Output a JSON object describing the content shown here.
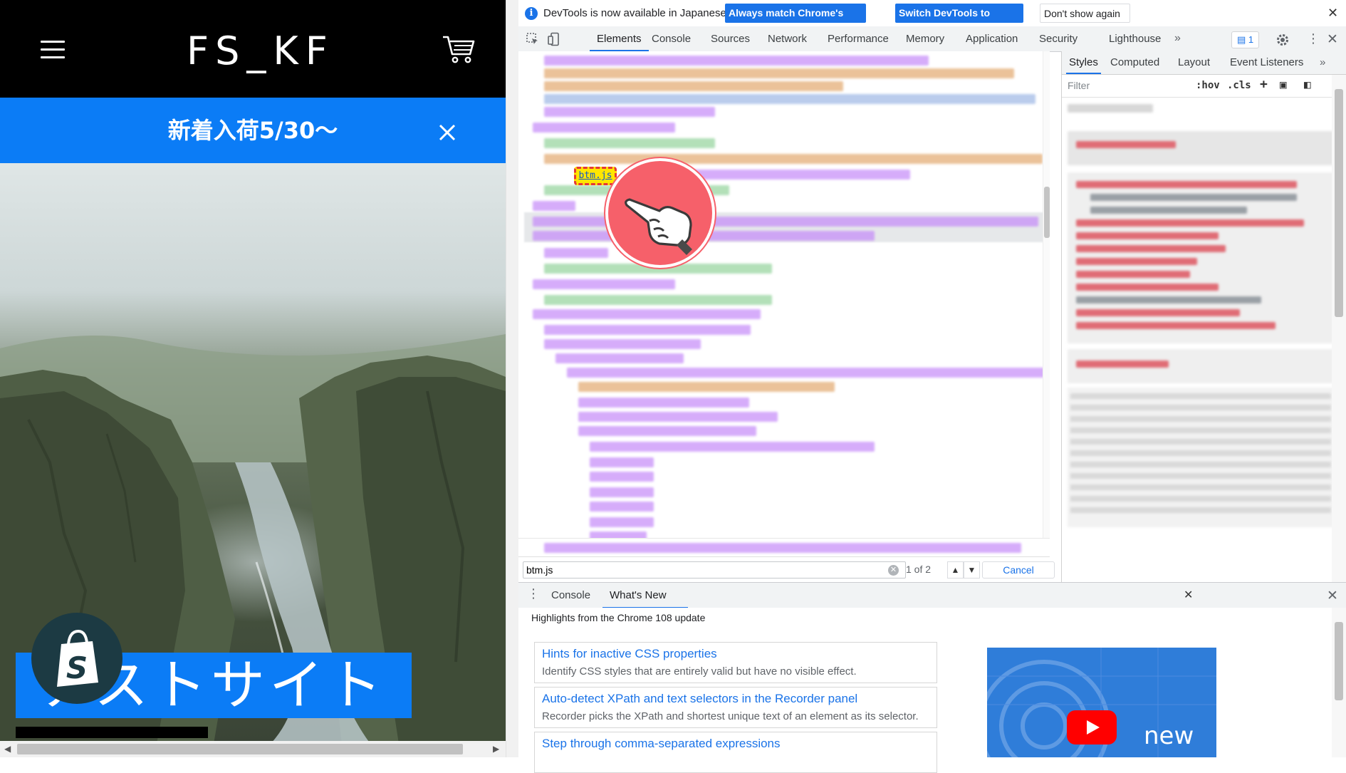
{
  "site": {
    "logo": "FS_KF",
    "announcement": "新着入荷5/30〜",
    "hero_title": "テストサイト"
  },
  "devtools": {
    "infobar": {
      "message": "DevTools is now available in Japanese!",
      "btn_always_match": "Always match Chrome's language",
      "btn_switch": "Switch DevTools to Japanese",
      "btn_dont_show": "Don't show again"
    },
    "main_tabs": [
      "Elements",
      "Console",
      "Sources",
      "Network",
      "Performance",
      "Memory",
      "Application",
      "Security",
      "Lighthouse"
    ],
    "issues_count": "1",
    "elements": {
      "found_text": "btm.js"
    },
    "search": {
      "value": "btm.js",
      "match_count": "1 of 2",
      "cancel_label": "Cancel"
    },
    "styles_tabs": [
      "Styles",
      "Computed",
      "Layout",
      "Event Listeners"
    ],
    "styles": {
      "filter_placeholder": "Filter",
      "hov": ":hov",
      "cls": ".cls"
    },
    "drawer": {
      "tabs": [
        "Console",
        "What's New"
      ],
      "heading": "Highlights from the Chrome 108 update",
      "features": [
        {
          "title": "Hints for inactive CSS properties",
          "desc": "Identify CSS styles that are entirely valid but have no visible effect."
        },
        {
          "title": "Auto-detect XPath and text selectors in the Recorder panel",
          "desc": "Recorder picks the XPath and shortest unique text of an element as its selector."
        },
        {
          "title": "Step through comma-separated expressions",
          "desc": ""
        }
      ],
      "promo_text": "new"
    }
  },
  "colors": {
    "brand_blue": "#0b7cf6",
    "devtools_accent": "#1a73e8",
    "search_highlight": "#ffe600",
    "pointer_red": "#f6606a"
  },
  "icons": [
    "hamburger-icon",
    "cart-icon",
    "close-icon",
    "shopify-icon",
    "info-icon",
    "inspect-icon",
    "device-toolbar-icon",
    "settings-icon",
    "kebab-icon",
    "pointer-hand-icon",
    "youtube-play-icon"
  ]
}
